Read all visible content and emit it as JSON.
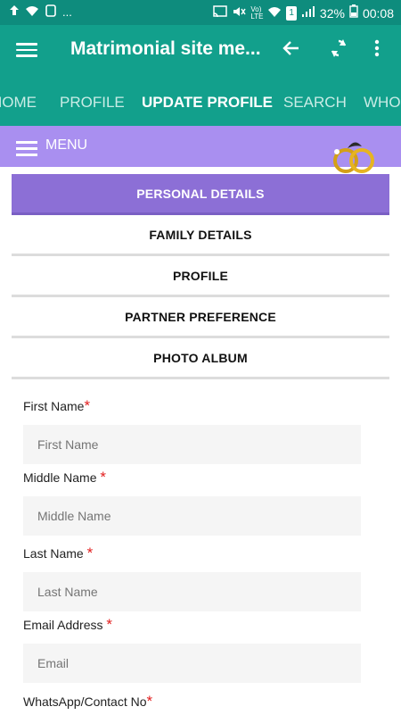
{
  "status": {
    "left_dots": "...",
    "battery": "32%",
    "time": "00:08",
    "network_label": "Vo) LTE",
    "sim": "1"
  },
  "appbar": {
    "title": "Matrimonial site me..."
  },
  "tabs": [
    {
      "label": "HOME"
    },
    {
      "label": "PROFILE"
    },
    {
      "label": "UPDATE PROFILE"
    },
    {
      "label": "SEARCH"
    },
    {
      "label": "WHO"
    }
  ],
  "menu": {
    "label": "MENU"
  },
  "sections": [
    {
      "label": "PERSONAL DETAILS"
    },
    {
      "label": "FAMILY DETAILS"
    },
    {
      "label": "PROFILE"
    },
    {
      "label": "PARTNER PREFERENCE"
    },
    {
      "label": "PHOTO ALBUM"
    }
  ],
  "form": {
    "first_name": {
      "label": "First Name",
      "placeholder": "First Name"
    },
    "middle_name": {
      "label": "Middle Name ",
      "placeholder": "Middle Name"
    },
    "last_name": {
      "label": "Last Name ",
      "placeholder": "Last Name"
    },
    "email": {
      "label": "Email Address ",
      "placeholder": "Email"
    },
    "whatsapp": {
      "label": "WhatsApp/Contact No"
    },
    "required_mark": "*"
  },
  "colors": {
    "statusbar": "#0e8c7d",
    "appbar": "#12a08c",
    "menubar": "#a98ff0",
    "section_active": "#8c6fd6",
    "required": "#e21e1e"
  }
}
